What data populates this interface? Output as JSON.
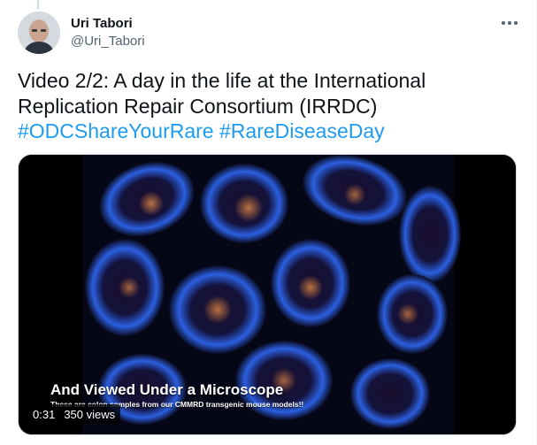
{
  "tweet": {
    "author_name": "Uri Tabori",
    "author_handle": "@Uri_Tabori",
    "text_plain": "Video 2/2: A day in the life at the International Replication Repair Consortium (IRRDC)",
    "hashtags": [
      "#ODCShareYourRare",
      "#RareDiseaseDay"
    ],
    "more_icon": "more-horizontal-icon"
  },
  "media": {
    "caption_title": "And Viewed Under a Microscope",
    "caption_subtitle": "These are colon samples from our CMMRD transgenic mouse models!!",
    "elapsed": "0:31",
    "views": "350 views"
  },
  "colors": {
    "text": "#0f1419",
    "secondary": "#536471",
    "link": "#1d9bf0"
  }
}
